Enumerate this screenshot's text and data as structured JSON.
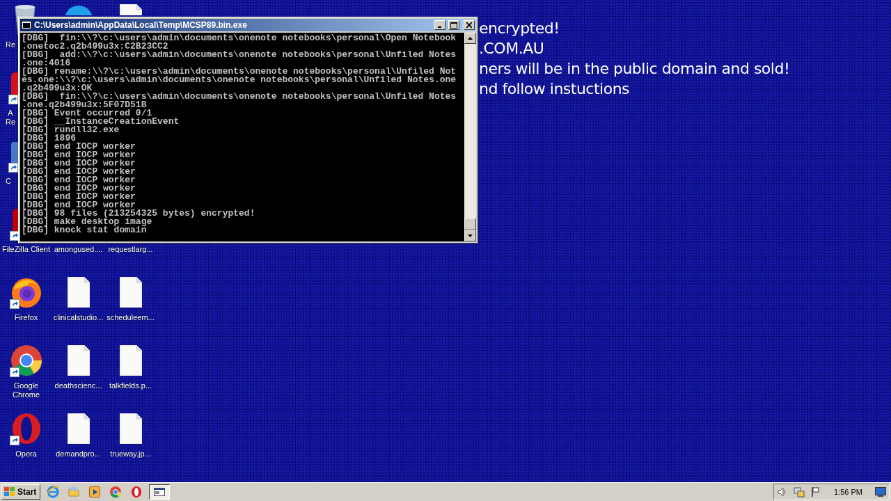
{
  "desktop": {
    "wallpaper_text": [
      "encrypted!",
      ".COM.AU",
      "ners will be in the public domain and sold!",
      "nd follow instuctions"
    ],
    "icon_rows": [
      [
        {
          "kind": "recycle",
          "label": "Re",
          "covered": true
        },
        {
          "kind": "skype"
        },
        {
          "kind": "file"
        }
      ],
      [
        {
          "kind": "reader",
          "label": "A\nRe",
          "covered": true
        },
        null,
        null
      ],
      [
        {
          "kind": "generic",
          "label": "C",
          "covered": true
        },
        null,
        null
      ],
      [
        {
          "kind": "filezilla",
          "label": "FileZilla Client"
        },
        {
          "label": "amongused...."
        },
        {
          "label": "requestlarg..."
        }
      ],
      [
        {
          "kind": "firefox",
          "label": "Firefox"
        },
        {
          "kind": "file",
          "label": "clinicalstudio..."
        },
        {
          "kind": "file",
          "label": "scheduleem..."
        }
      ],
      [
        {
          "kind": "chrome",
          "label": "Google Chrome"
        },
        {
          "kind": "file",
          "label": "deathscienc..."
        },
        {
          "kind": "file",
          "label": "talkfields.p..."
        }
      ],
      [
        {
          "kind": "opera",
          "label": "Opera"
        },
        {
          "kind": "file",
          "label": "demandpro..."
        },
        {
          "kind": "file",
          "label": "trueway.jp..."
        }
      ]
    ]
  },
  "console": {
    "title": "C:\\Users\\admin\\AppData\\Local\\Temp\\MCSP89.bin.exe",
    "lines": [
      "[DBG]  fin:\\\\?\\c:\\users\\admin\\documents\\onenote notebooks\\personal\\Open Notebook",
      ".onetoc2.q2b499u3x:C2B23CC2",
      "[DBG]  add:\\\\?\\c:\\users\\admin\\documents\\onenote notebooks\\personal\\Unfiled Notes",
      ".one:4016",
      "[DBG] rename:\\\\?\\c:\\users\\admin\\documents\\onenote notebooks\\personal\\Unfiled Not",
      "es.one:\\\\?\\c:\\users\\admin\\documents\\onenote notebooks\\personal\\Unfiled Notes.one",
      ".q2b499u3x:OK",
      "[DBG]  fin:\\\\?\\c:\\users\\admin\\documents\\onenote notebooks\\personal\\Unfiled Notes",
      ".one.q2b499u3x:5F07D51B",
      "[DBG] Event occurred 0/1",
      "[DBG] __InstanceCreationEvent",
      "[DBG] rundll32.exe",
      "[DBG] 1896",
      "[DBG] end IOCP worker",
      "[DBG] end IOCP worker",
      "[DBG] end IOCP worker",
      "[DBG] end IOCP worker",
      "[DBG] end IOCP worker",
      "[DBG] end IOCP worker",
      "[DBG] end IOCP worker",
      "[DBG] end IOCP worker",
      "[DBG] 98 files (213254325 bytes) encrypted!",
      "[DBG] make desktop image",
      "[DBG] knock stat domain"
    ]
  },
  "taskbar": {
    "start_label": "Start",
    "apps": [
      {
        "kind": "ie",
        "selected": false
      },
      {
        "kind": "explorer",
        "selected": false
      },
      {
        "kind": "media",
        "selected": false
      },
      {
        "kind": "chrome",
        "selected": false
      },
      {
        "kind": "opera",
        "selected": false
      },
      {
        "kind": "console",
        "selected": true
      }
    ],
    "time": "1:56 PM"
  }
}
